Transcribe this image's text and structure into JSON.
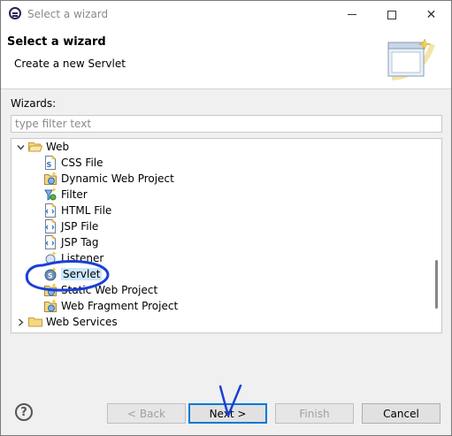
{
  "window": {
    "title": "Select a wizard",
    "minimize": "–",
    "close": "✕"
  },
  "header": {
    "title": "Select a wizard",
    "description": "Create a new Servlet"
  },
  "wizards_label": "Wizards:",
  "filter": {
    "placeholder": "type filter text",
    "value": ""
  },
  "tree": {
    "web_folder": "Web",
    "items": [
      {
        "label": "CSS File",
        "icon": "css-file-icon"
      },
      {
        "label": "Dynamic Web Project",
        "icon": "dynamic-web-project-icon"
      },
      {
        "label": "Filter",
        "icon": "filter-icon"
      },
      {
        "label": "HTML File",
        "icon": "html-file-icon"
      },
      {
        "label": "JSP File",
        "icon": "jsp-file-icon"
      },
      {
        "label": "JSP Tag",
        "icon": "jsp-tag-icon"
      },
      {
        "label": "Listener",
        "icon": "listener-icon"
      },
      {
        "label": "Servlet",
        "icon": "servlet-icon",
        "selected": true
      },
      {
        "label": "Static Web Project",
        "icon": "static-web-project-icon"
      },
      {
        "label": "Web Fragment Project",
        "icon": "web-fragment-project-icon"
      }
    ],
    "web_services_folder": "Web Services"
  },
  "buttons": {
    "help": "?",
    "back": "< Back",
    "next": "Next >",
    "finish": "Finish",
    "cancel": "Cancel"
  },
  "colors": {
    "annotation": "#1a3fd6",
    "selection": "#cce8ff",
    "default_button_border": "#0078d7"
  }
}
